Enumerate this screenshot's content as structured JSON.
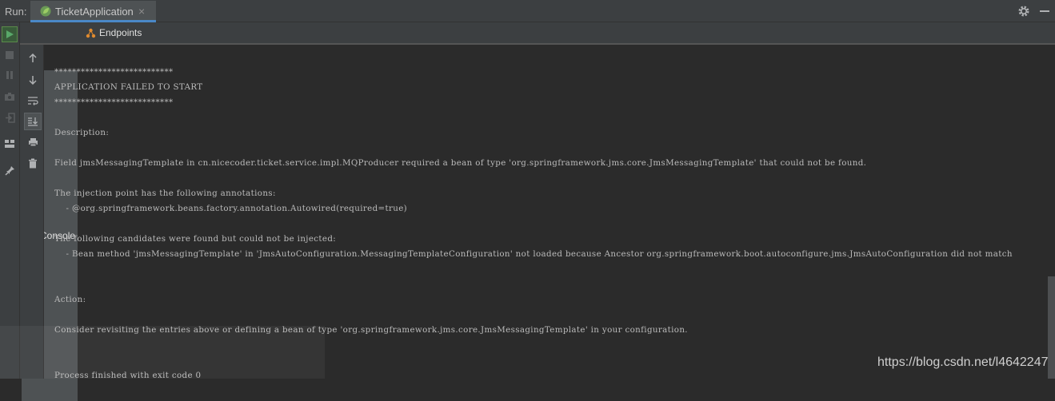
{
  "run_bar": {
    "label": "Run:",
    "tab_title": "TicketApplication",
    "tab_close": "×"
  },
  "tabs": {
    "console": "Console",
    "endpoints": "Endpoints"
  },
  "console_lines": [
    "***************************",
    "APPLICATION FAILED TO START",
    "***************************",
    "",
    "Description:",
    "",
    "Field jmsMessagingTemplate in cn.nicecoder.ticket.service.impl.MQProducer required a bean of type 'org.springframework.jms.core.JmsMessagingTemplate' that could not be found.",
    "",
    "The injection point has the following annotations:",
    "    - @org.springframework.beans.factory.annotation.Autowired(required=true)",
    "",
    "The following candidates were found but could not be injected:",
    "    - Bean method 'jmsMessagingTemplate' in 'JmsAutoConfiguration.MessagingTemplateConfiguration' not loaded because Ancestor org.springframework.boot.autoconfigure.jms.JmsAutoConfiguration did not match",
    "",
    "",
    "Action:",
    "",
    "Consider revisiting the entries above or defining a bean of type 'org.springframework.jms.core.JmsMessagingTemplate' in your configuration.",
    "",
    "",
    "Process finished with exit code 0"
  ],
  "watermark": "https://blog.csdn.net/l4642247",
  "colors": {
    "background": "#2b2b2b",
    "panel": "#3c3f41",
    "tab_accent": "#4a88c7",
    "text": "#bbbbbb",
    "run_green": "#59a869"
  }
}
